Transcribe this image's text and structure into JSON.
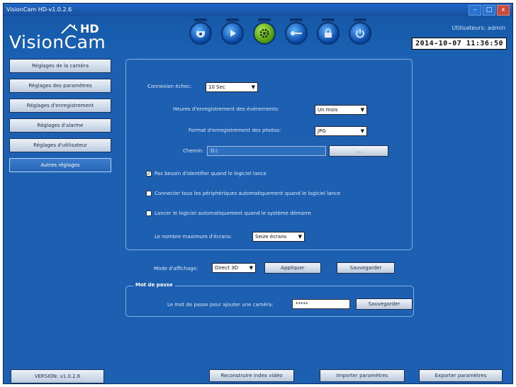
{
  "window": {
    "title": "VisionCam HD-v1.0.2.6",
    "minimize": "–",
    "maximize": "□",
    "close": "x"
  },
  "logo": {
    "main": "VisionCam",
    "hd": "HD"
  },
  "header": {
    "user": "Utilisateurs: admin",
    "datetime": "2014-10-07 11:36:50",
    "nav_icons": [
      "camera-dome-icon",
      "play-icon",
      "gear-icon",
      "key-icon",
      "lock-icon",
      "power-icon"
    ],
    "active_icon": "gear-icon"
  },
  "sidebar": {
    "items": [
      {
        "label": "Réglages de la caméra"
      },
      {
        "label": "Réglages des paramètres"
      },
      {
        "label": "Réglages d'enregistrement"
      },
      {
        "label": "Réglages d'alarme"
      },
      {
        "label": "Réglages d'utilisateur"
      },
      {
        "label": "Autres réglages"
      }
    ],
    "version": "VERSION: v1.0.2.6"
  },
  "settings": {
    "connexion_label": "Connexion échec:",
    "connexion_value": "10 Sec",
    "event_label": "Heures d'enregistrement des événements:",
    "event_value": "Un mois",
    "photo_label": "Format d'enregistrement des photos:",
    "photo_value": "JPG",
    "path_label": "Chemin:",
    "path_value": "D:\\",
    "browse_label": "...",
    "check1": "Pas besoin d'identifier quand le logiciel lance",
    "check2": "Connecter tous les périphériques automatiquement quand le logiciel lance",
    "check3": "Lancer le logiciel automatiquement quand le système démarre",
    "screens_label": "Le nombre maximum d'écrans:",
    "screens_value": "Seize écrans",
    "check_states": [
      true,
      false,
      false
    ]
  },
  "display": {
    "mode_label": "Mode d'affichage:",
    "mode_value": "Direct 3D",
    "apply": "Appliquer",
    "save": "Sauvegarder"
  },
  "password": {
    "legend": "Mot de passe",
    "label": "Le mot de passe pour ajouter une caméra:",
    "value": "*****",
    "save": "Sauvegarder"
  },
  "footer": {
    "rebuild": "Reconstruire index vidéo",
    "import": "Importer paramètres",
    "export": "Exporter paramètres"
  }
}
